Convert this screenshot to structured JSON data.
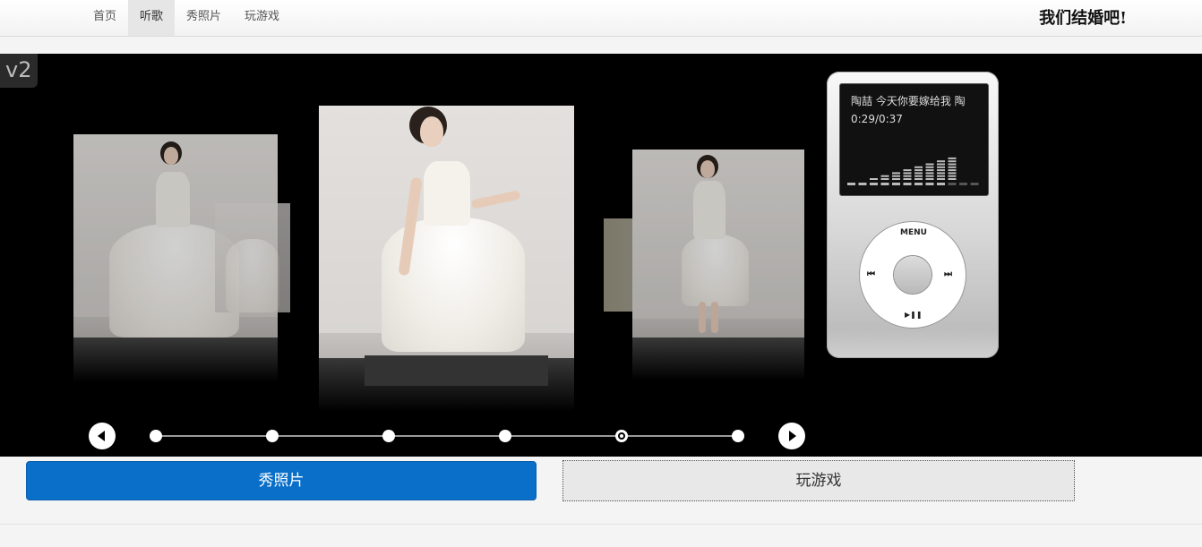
{
  "nav": {
    "items": [
      {
        "label": "首页",
        "active": false
      },
      {
        "label": "听歌",
        "active": true
      },
      {
        "label": "秀照片",
        "active": false
      },
      {
        "label": "玩游戏",
        "active": false
      }
    ],
    "brand": "我们结婚吧!"
  },
  "stage": {
    "version_badge": "v2",
    "pager": {
      "count": 6,
      "current_index": 4
    },
    "prev_icon": "play-left-icon",
    "next_icon": "play-right-icon"
  },
  "player": {
    "track": "陶喆 今天你要嫁给我 陶",
    "time": "0:29/0:37",
    "menu_label": "MENU",
    "prev_label": "⏮",
    "next_label": "⏭",
    "play_pause_label": "▶❚❚"
  },
  "buttons": {
    "photos": "秀照片",
    "games": "玩游戏"
  },
  "colors": {
    "primary": "#0a6fc9",
    "stage_bg": "#000000",
    "active_nav": "#e6e6e6"
  }
}
